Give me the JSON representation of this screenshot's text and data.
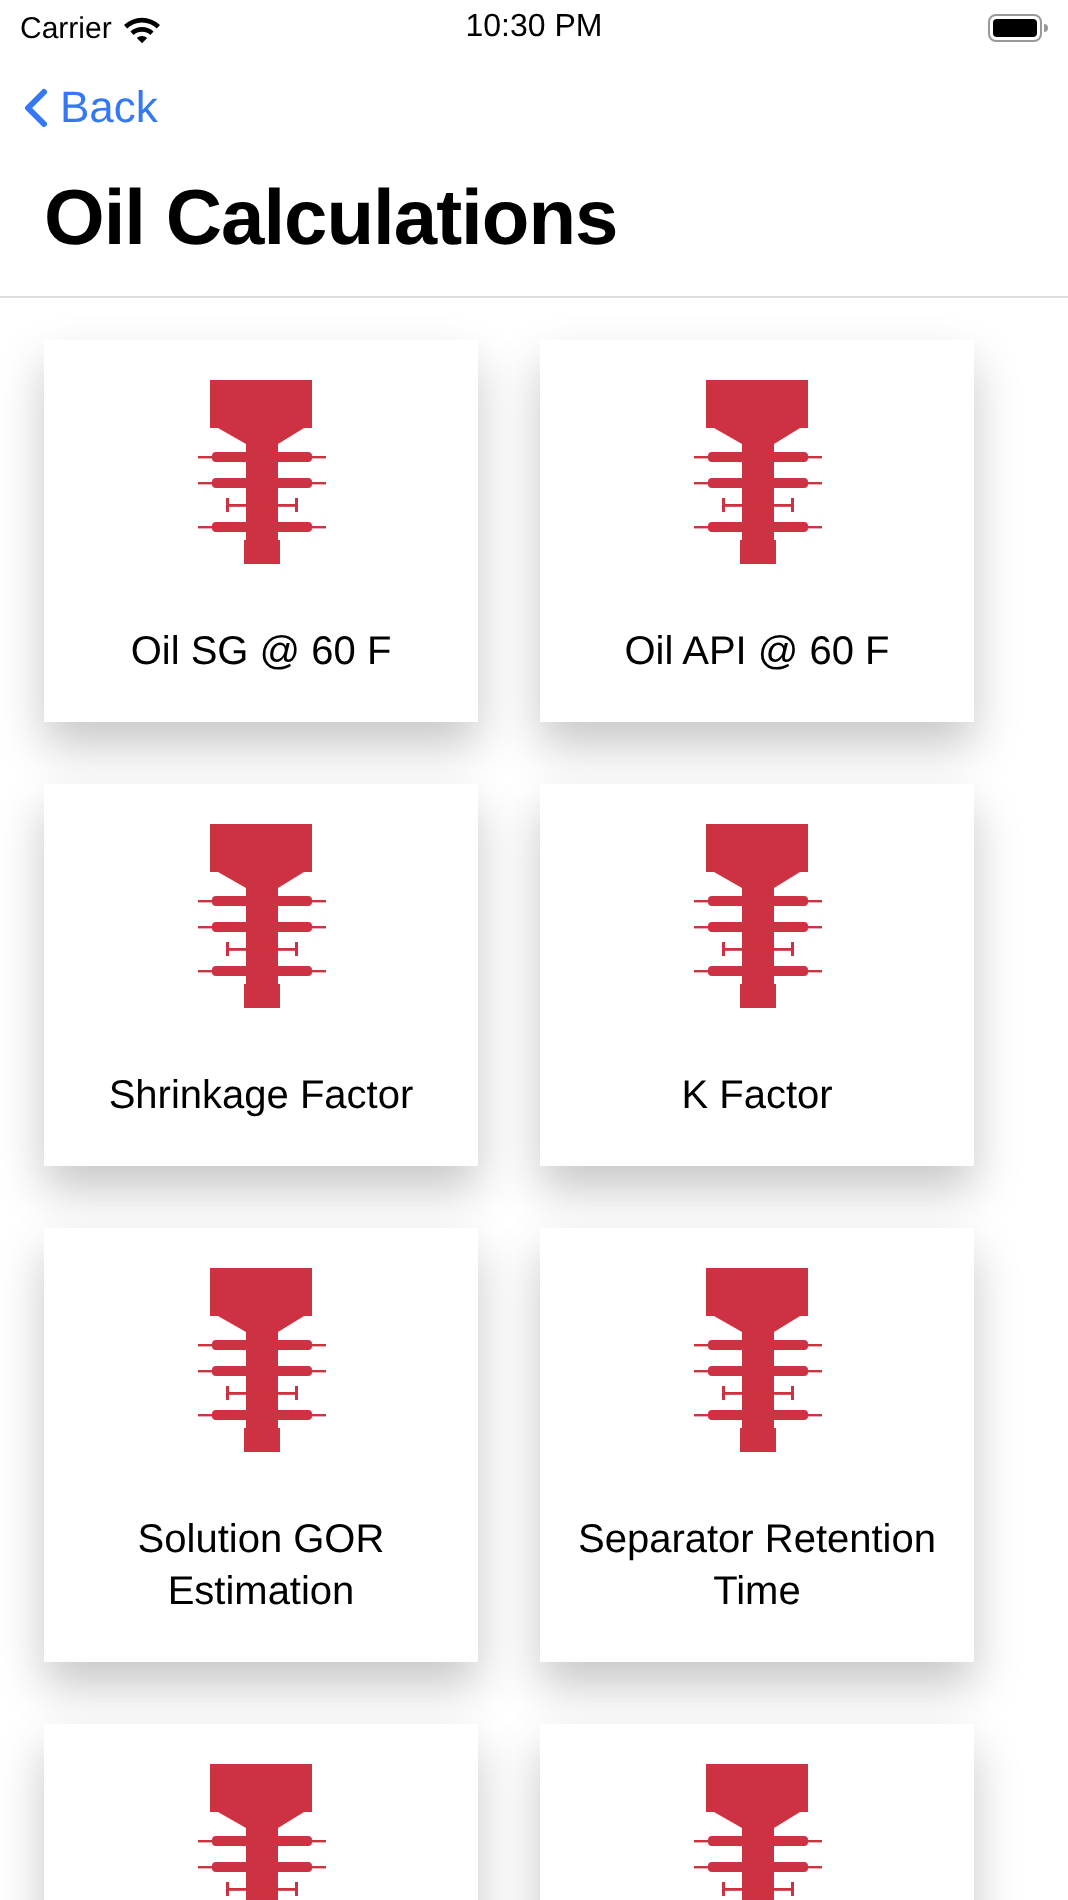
{
  "status_bar": {
    "carrier": "Carrier",
    "time": "10:30 PM"
  },
  "nav": {
    "back": "Back",
    "title": "Oil Calculations"
  },
  "tiles": [
    {
      "kind": "labeled",
      "label": "Oil SG @ 60 F"
    },
    {
      "kind": "labeled",
      "label": "Oil API @ 60 F"
    },
    {
      "kind": "labeled",
      "label": "Shrinkage Factor"
    },
    {
      "kind": "labeled",
      "label": "K Factor"
    },
    {
      "kind": "labeled",
      "label": "Solution GOR Estimation"
    },
    {
      "kind": "labeled",
      "label": "Separator Retention Time"
    },
    {
      "kind": "cut_off"
    },
    {
      "kind": "cut_off"
    }
  ]
}
